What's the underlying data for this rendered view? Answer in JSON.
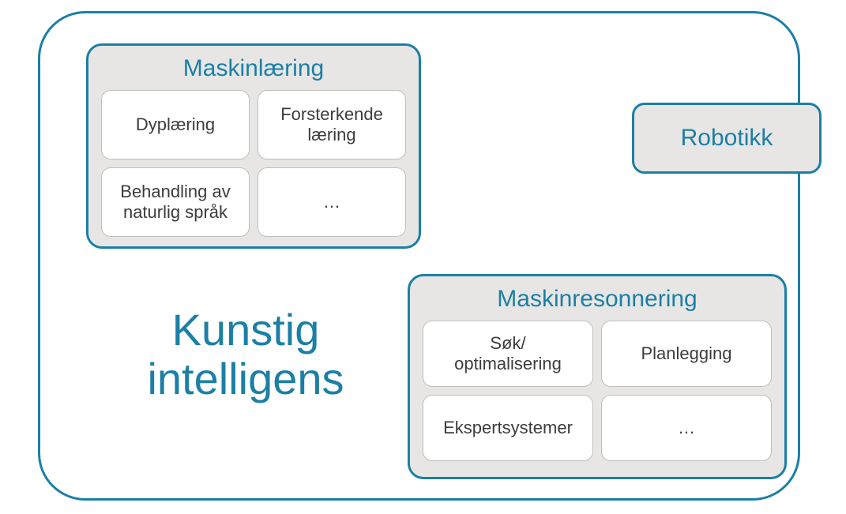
{
  "main_title": "Kunstig intelligens",
  "robotics_label": "Robotikk",
  "groups": {
    "ml": {
      "title": "Maskinlæring",
      "cells": [
        "Dyplæring",
        "Forsterkende\nlæring",
        "Behandling av\nnaturlig språk",
        "…"
      ]
    },
    "mr": {
      "title": "Maskinresonnering",
      "cells": [
        "Søk/\noptimalisering",
        "Planlegging",
        "Ekspertsystemer",
        "…"
      ]
    }
  }
}
